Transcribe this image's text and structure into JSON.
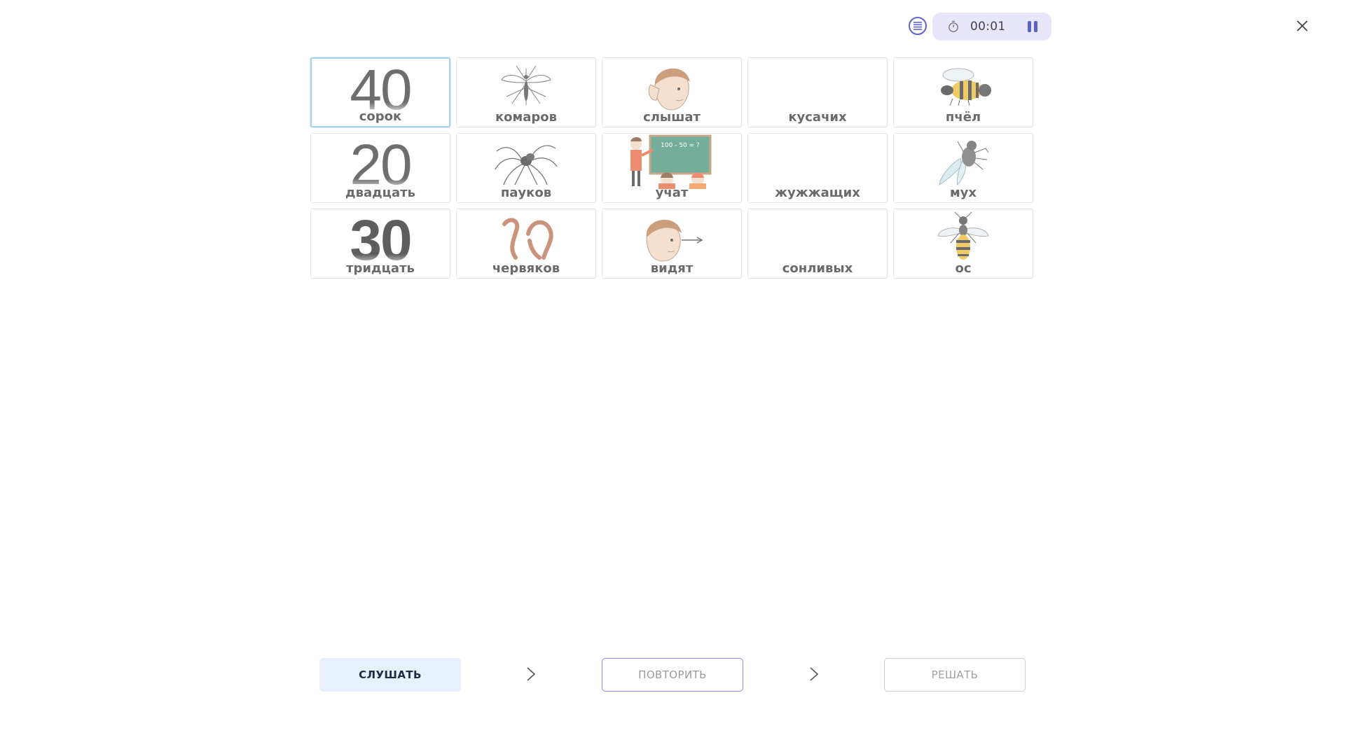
{
  "toolbar": {
    "timer": "00:01",
    "icons": {
      "menu": "list-icon",
      "timer": "stopwatch-icon",
      "pause": "pause-icon",
      "close": "close-icon"
    }
  },
  "grid": {
    "cards": [
      {
        "label": "сорок",
        "number": "40",
        "selected": true
      },
      {
        "label": "комаров",
        "icon": "mosquito-icon"
      },
      {
        "label": "слышат",
        "icon": "boy-listening-icon"
      },
      {
        "label": "кусачих"
      },
      {
        "label": "пчёл",
        "icon": "bee-icon"
      },
      {
        "label": "двадцать",
        "number": "20"
      },
      {
        "label": "пауков",
        "icon": "spider-icon"
      },
      {
        "label": "учат",
        "icon": "teacher-blackboard-icon",
        "board_text": "100 - 50 = ?"
      },
      {
        "label": "жужжащих"
      },
      {
        "label": "мух",
        "icon": "fly-icon"
      },
      {
        "label": "тридцать",
        "number": "30"
      },
      {
        "label": "червяков",
        "icon": "worms-icon"
      },
      {
        "label": "видят",
        "icon": "boy-looking-icon"
      },
      {
        "label": "сонливых"
      },
      {
        "label": "ос",
        "icon": "wasp-icon"
      }
    ]
  },
  "actions": {
    "listen": "СЛУШАТЬ",
    "repeat": "ПОВТОРИТЬ",
    "solve": "РЕШАТЬ",
    "arrow_icon": "chevron-right-icon"
  },
  "colors": {
    "accent": "#5b63c9",
    "timer_bg": "#e7e6fa",
    "listen_bg": "#e7f0fb",
    "selected_border": "#a9d1ea"
  }
}
